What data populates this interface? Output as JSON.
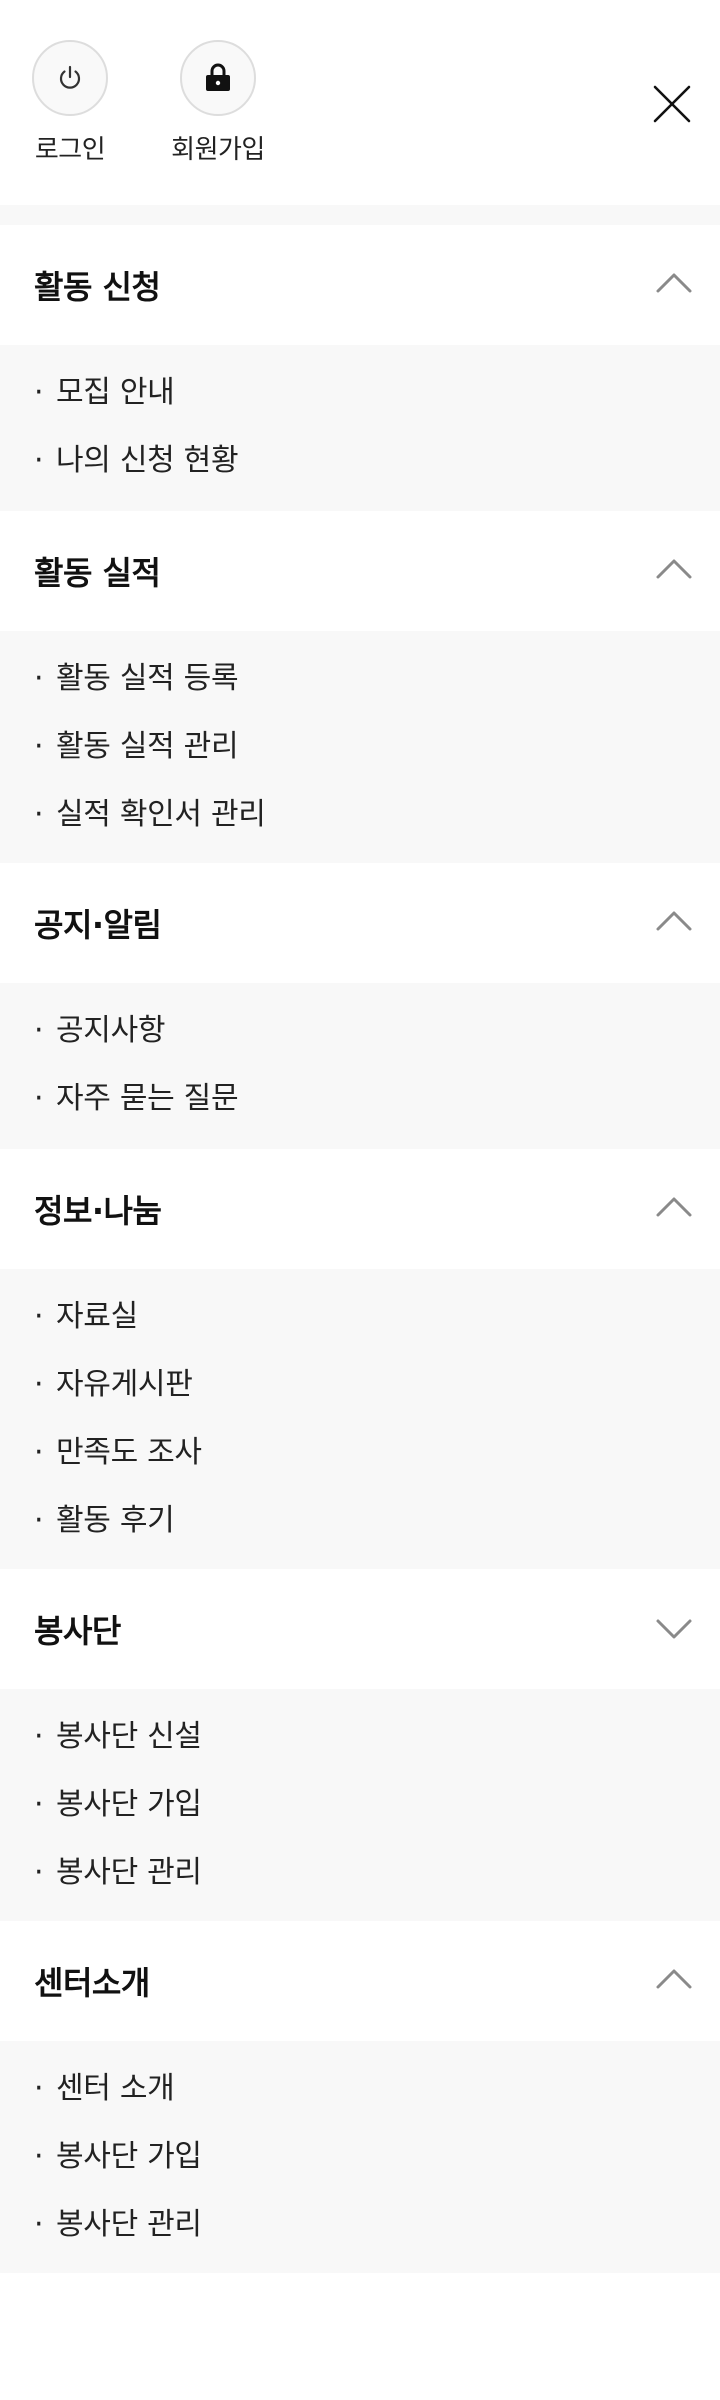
{
  "header": {
    "login": {
      "label": "로그인",
      "icon": "power-icon"
    },
    "signup": {
      "label": "회원가입",
      "icon": "lock-icon"
    },
    "close": {
      "icon": "close-icon"
    }
  },
  "menu": {
    "sections": [
      {
        "title": "활동 신청",
        "expanded": true,
        "chevron": "chevron-up-icon",
        "items": [
          "모집 안내",
          "나의 신청 현황"
        ]
      },
      {
        "title": "활동 실적",
        "expanded": true,
        "chevron": "chevron-up-icon",
        "items": [
          "활동 실적 등록",
          "활동 실적 관리",
          "실적 확인서 관리"
        ]
      },
      {
        "title": "공지·알림",
        "expanded": true,
        "chevron": "chevron-up-icon",
        "items": [
          "공지사항",
          "자주 묻는 질문"
        ]
      },
      {
        "title": "정보·나눔",
        "expanded": true,
        "chevron": "chevron-up-icon",
        "items": [
          "자료실",
          "자유게시판",
          "만족도 조사",
          "활동 후기"
        ]
      },
      {
        "title": "봉사단",
        "expanded": true,
        "chevron": "chevron-down-icon",
        "items": [
          "봉사단 신설",
          "봉사단 가입",
          "봉사단 관리"
        ]
      },
      {
        "title": "센터소개",
        "expanded": true,
        "chevron": "chevron-up-icon",
        "items": [
          "센터 소개",
          "봉사단 가입",
          "봉사단 관리"
        ]
      }
    ]
  },
  "colors": {
    "text": "#111111",
    "submenu_bg": "#f8f8f8",
    "chevron": "#8a8a8a",
    "circle_border": "#dddddd"
  }
}
